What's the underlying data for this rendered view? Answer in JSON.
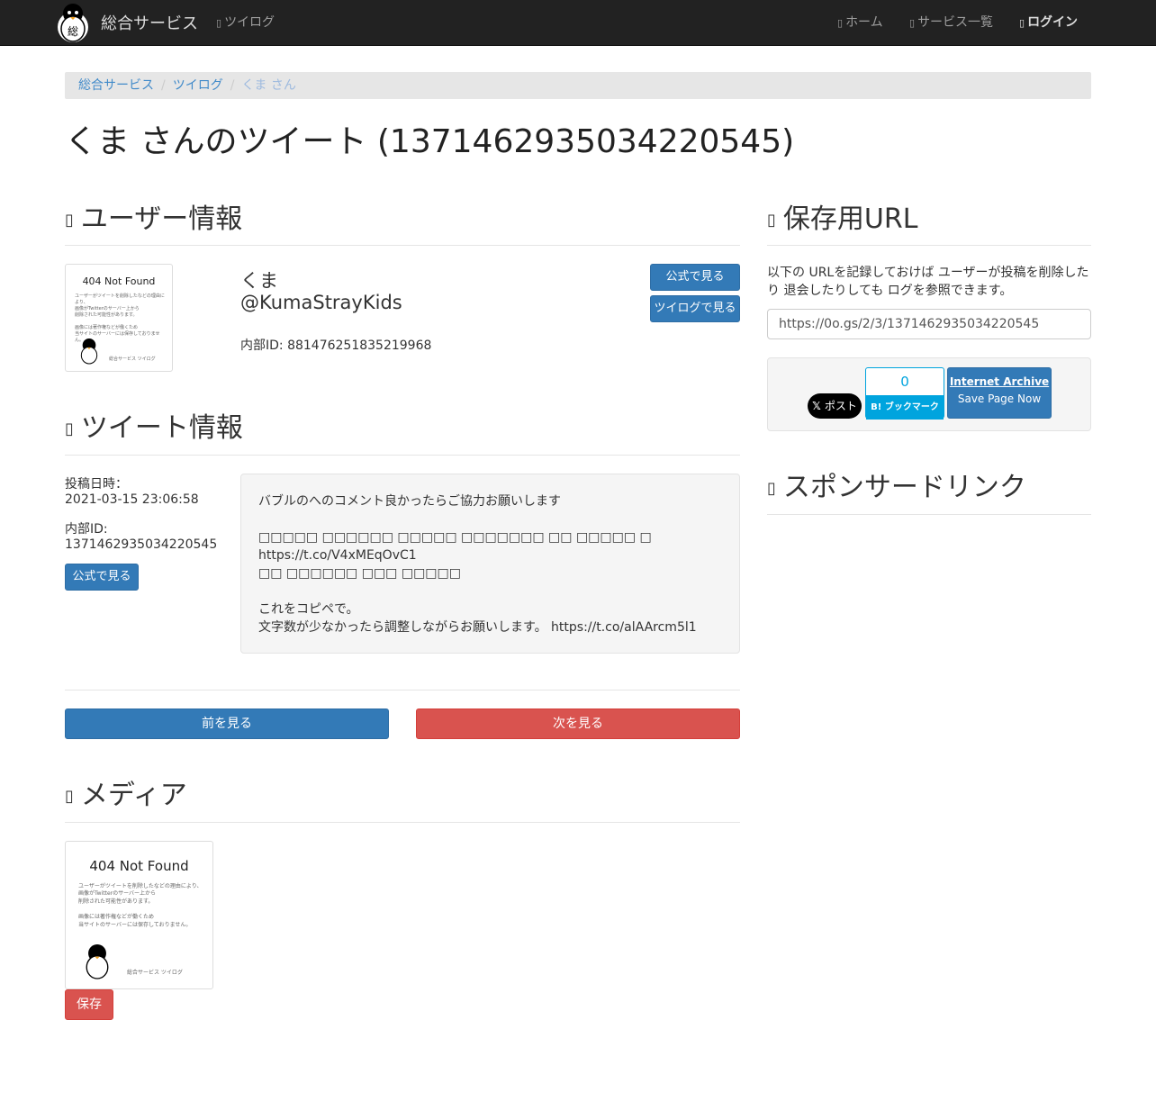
{
  "nav": {
    "brand": "総合サービス",
    "twilog": "ツイログ",
    "home": "ホーム",
    "services": "サービス一覧",
    "login": "ログイン"
  },
  "breadcrumb": [
    "総合サービス",
    "ツイログ",
    "くま さん"
  ],
  "page_title": "くま さんのツイート (1371462935034220545)",
  "user_section": {
    "heading": "ユーザー情報",
    "name": "くま",
    "handle": "@KumaStrayKids",
    "internal_id": "内部ID: 881476251835219968",
    "btn_official": "公式で見る",
    "btn_twilog": "ツイログで見る",
    "avatar": {
      "title": "404 Not Found",
      "lines": [
        "ユーザーがツイートを削除したなどの理由により、",
        "画像がTwitterのサーバー上から",
        "削除された可能性があります。",
        "",
        "画像には著作権などが働くため",
        "当サイトのサーバーには保存しておりません。"
      ],
      "footer": "総合サービス ツイログ"
    }
  },
  "tweet_section": {
    "heading": "ツイート情報",
    "posted_label": "投稿日時：",
    "posted_value": "2021-03-15 23:06:58",
    "id_label": "内部ID:",
    "id_value": "1371462935034220545",
    "btn_official": "公式で見る",
    "text_lines": [
      "バブルのへのコメント良かったらご協力お願いします",
      "",
      "□□□□□ □□□□□□ □□□□□ □□□□□□□ □□ □□□□□ □",
      "https://t.co/V4xMEqOvC1",
      "□□ □□□□□□ □□□ □□□□□",
      "",
      "これをコピペで。",
      "文字数が少なかったら調整しながらお願いします。 https://t.co/alAArcm5l1"
    ]
  },
  "pager": {
    "prev": "前を見る",
    "next": "次を見る"
  },
  "media_section": {
    "heading": "メディア",
    "save_btn": "保存"
  },
  "sidebar": {
    "url_heading": "保存用URL",
    "url_desc": "以下の URLを記録しておけば ユーザーが投稿を削除したり 退会したりしても ログを参照できます。",
    "url_value": "https://0o.gs/2/3/1371462935034220545",
    "x_button": "ポスト",
    "hatena_count": "0",
    "hatena_label": "B! ブックマーク",
    "ia_title": "Internet Archive",
    "ia_sub": "Save Page Now",
    "sponsor_heading": "スポンサードリンク"
  }
}
